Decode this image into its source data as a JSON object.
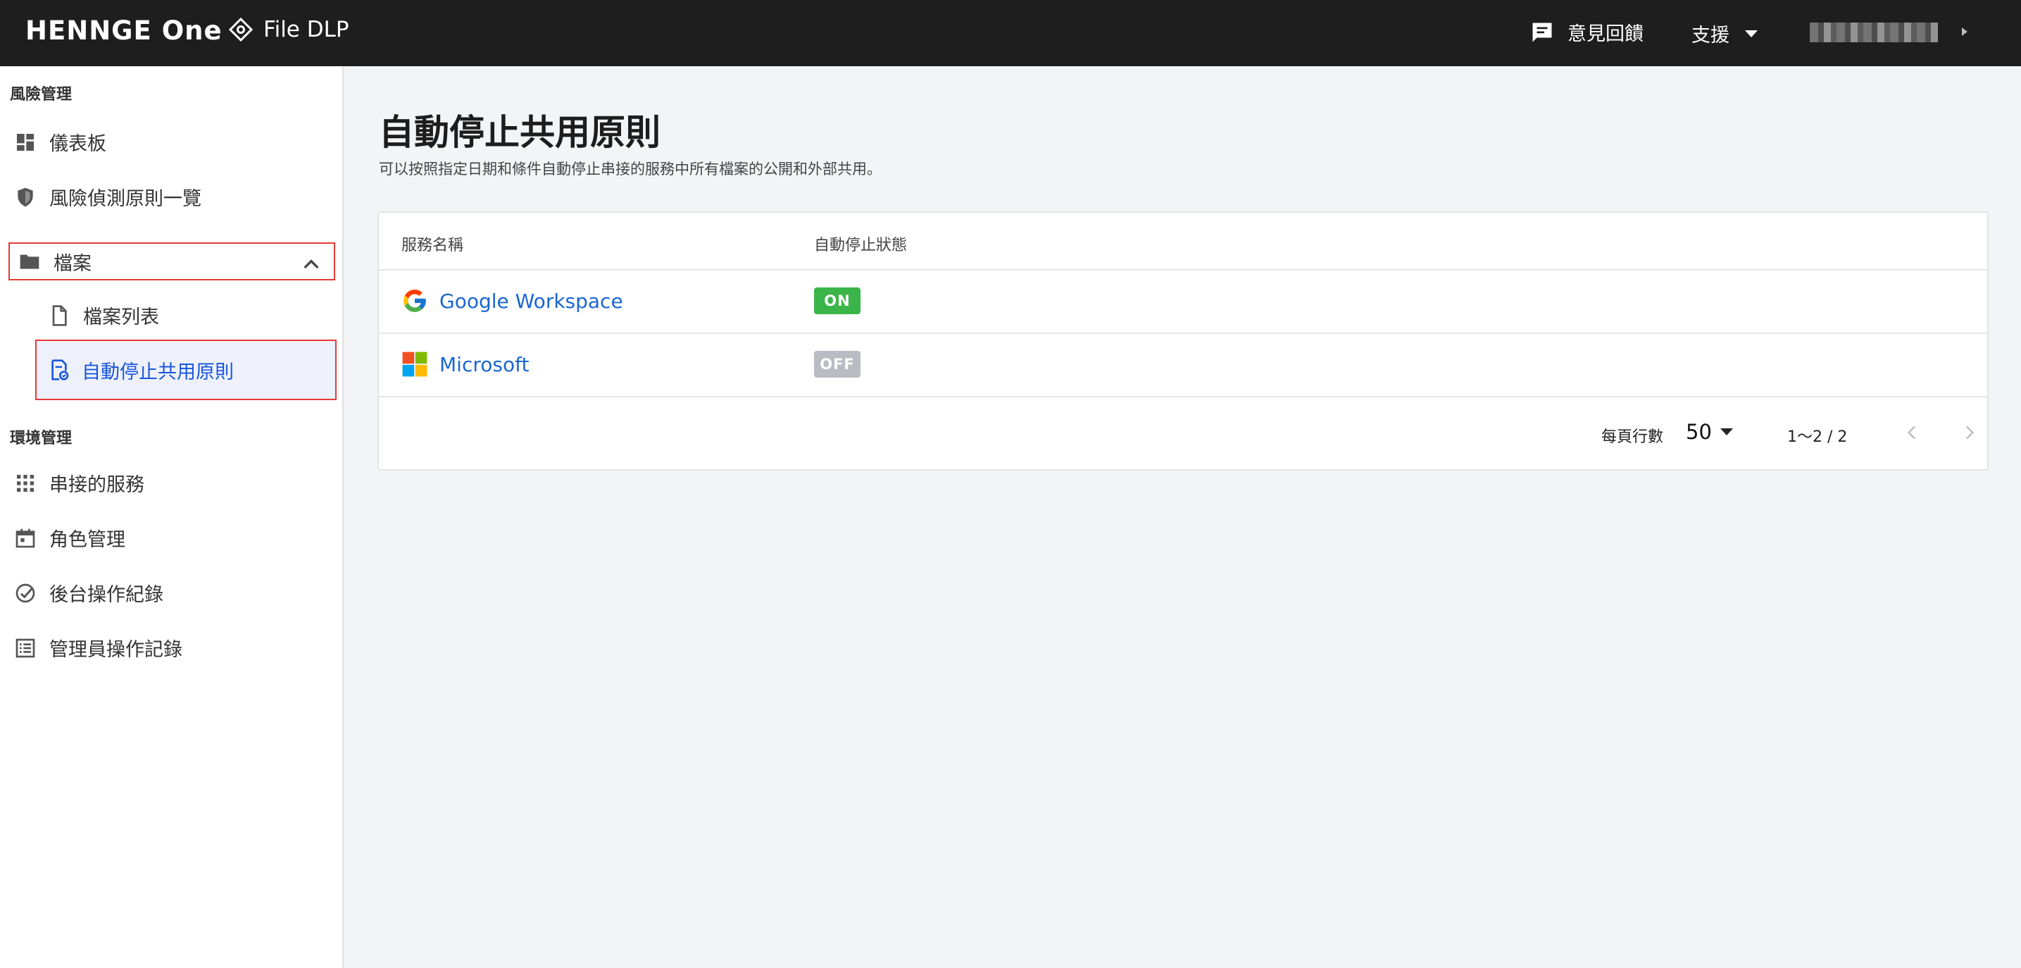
{
  "header": {
    "brand": "HENNGE One",
    "product": "File DLP",
    "feedback_label": "意見回饋",
    "support_label": "支援"
  },
  "sidebar": {
    "section_risk": "風險管理",
    "items": {
      "dashboard": "儀表板",
      "risk_policies": "風險偵測原則一覽",
      "files": "檔案",
      "file_list": "檔案列表",
      "auto_stop": "自動停止共用原則"
    },
    "section_env": "環境管理",
    "env_items": {
      "connected_services": "串接的服務",
      "roles": "角色管理",
      "backend_logs": "後台操作紀錄",
      "admin_logs": "管理員操作記錄"
    }
  },
  "main": {
    "title": "自動停止共用原則",
    "description": "可以按照指定日期和條件自動停止串接的服務中所有檔案的公開和外部共用。",
    "table": {
      "columns": [
        "服務名稱",
        "自動停止狀態"
      ],
      "rows": [
        {
          "service": "Google Workspace",
          "status": "ON",
          "status_color": "#3bb54a"
        },
        {
          "service": "Microsoft",
          "status": "OFF",
          "status_color": "#b9bcc2"
        }
      ]
    },
    "pagination": {
      "rows_per_page_label": "每頁行數",
      "rows_per_page": "50",
      "range": "1〜2 / 2"
    }
  },
  "colors": {
    "topbar": "#1e1e1e",
    "link": "#1a66d2",
    "active_bg": "#eef1fc",
    "highlight_border": "#e53935"
  }
}
